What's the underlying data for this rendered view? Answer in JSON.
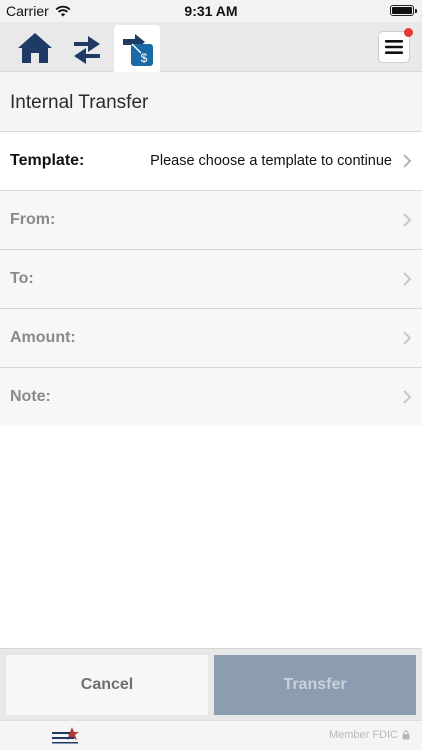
{
  "status": {
    "carrier": "Carrier",
    "time": "9:31 AM"
  },
  "nav": {
    "tabs": [
      "home-icon",
      "transfer-arrows-icon",
      "transfer-money-icon"
    ],
    "active_tab": 2,
    "menu_badge_color": "#e53935"
  },
  "page": {
    "title": "Internal Transfer"
  },
  "form": {
    "template_label": "Template:",
    "template_value": "Please choose a template to continue",
    "from_label": "From:",
    "to_label": "To:",
    "amount_label": "Amount:",
    "note_label": "Note:"
  },
  "actions": {
    "cancel_label": "Cancel",
    "transfer_label": "Transfer"
  },
  "footer": {
    "member_text": "Member FDIC"
  },
  "colors": {
    "brand_navy": "#1f3a64",
    "brand_blue": "#1a6aa6",
    "disabled_button": "#8c9db1"
  }
}
